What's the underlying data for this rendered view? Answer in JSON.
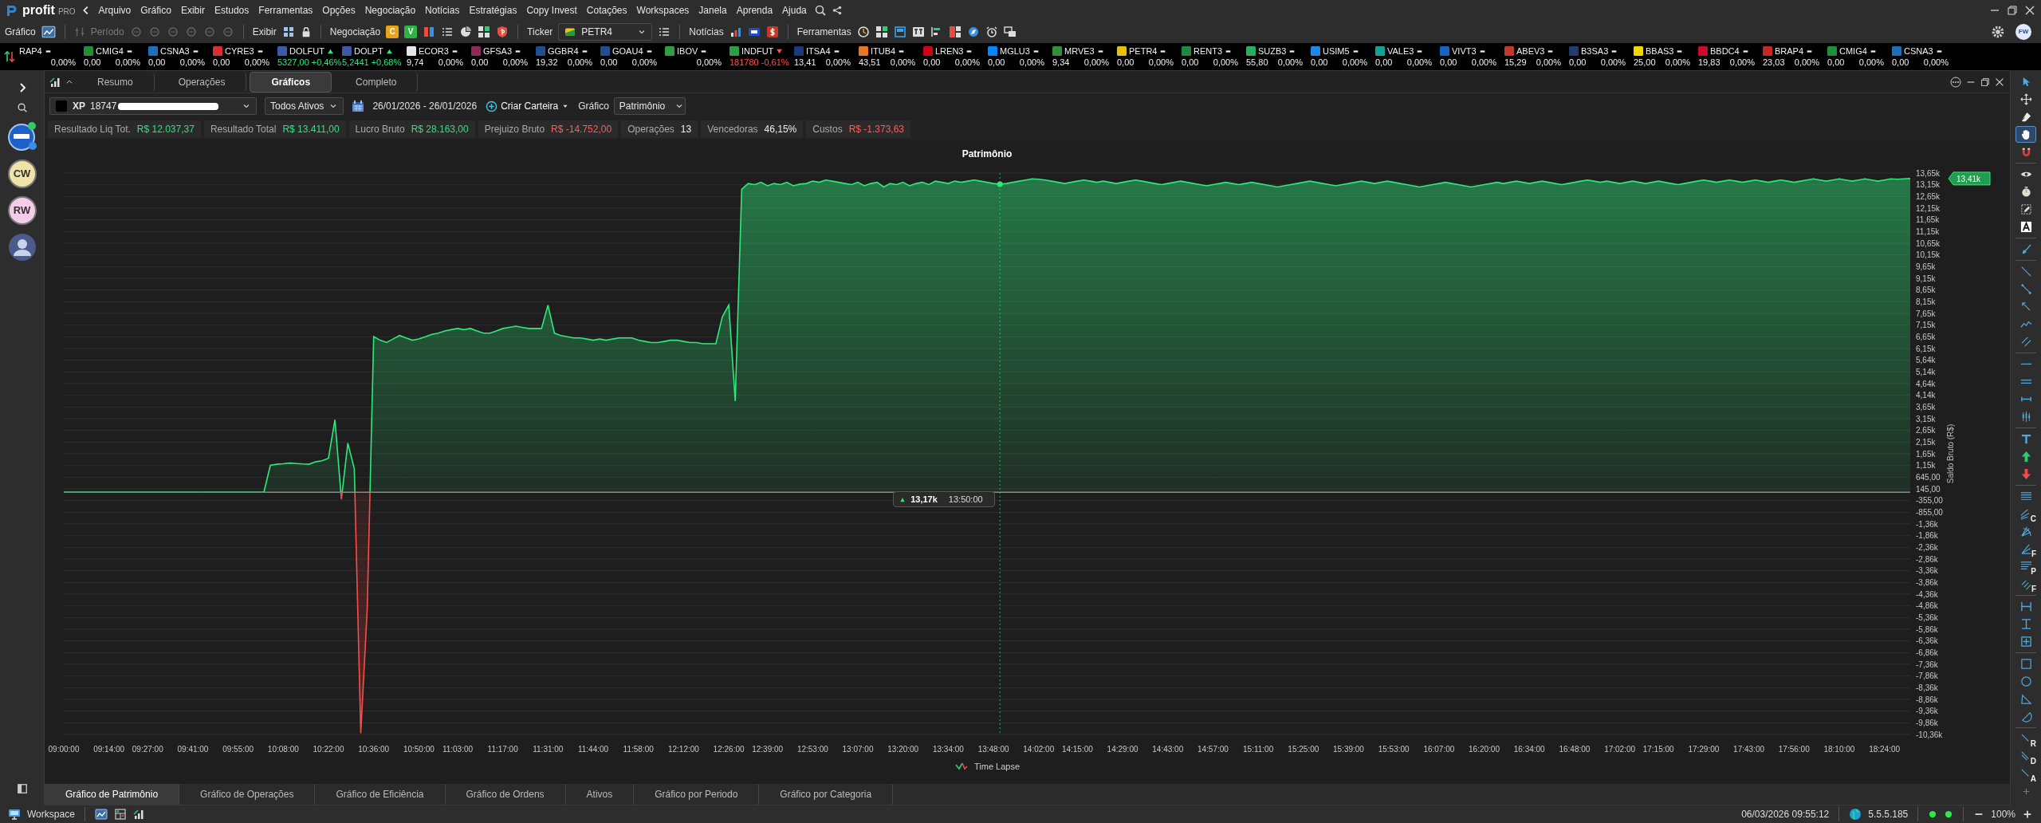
{
  "app": {
    "logo": "profit",
    "edition": "PRO"
  },
  "menu": [
    "Arquivo",
    "Gráfico",
    "Exibir",
    "Estudos",
    "Ferramentas",
    "Opções",
    "Negociação",
    "Notícias",
    "Estratégias",
    "Copy Invest",
    "Cotações",
    "Workspaces",
    "Janela",
    "Aprenda",
    "Ajuda"
  ],
  "toolbar": {
    "chart_label": "Gráfico",
    "period_label": "Período",
    "period_disabled": true,
    "view_label": "Exibir",
    "trading_label": "Negociação",
    "trading_buttons": [
      {
        "text": "C",
        "color": "#e8a317"
      },
      {
        "text": "V",
        "color": "#2fb344"
      }
    ],
    "ticker_label": "Ticker",
    "ticker_value": "PETR4",
    "news_label": "Notícias",
    "tools_label": "Ferramentas"
  },
  "user_avatar": "FW",
  "tickers": [
    {
      "symbol": "RAP4",
      "change": "0,00%",
      "kind": "flat"
    },
    {
      "symbol": "CMIG4",
      "price": "0,00",
      "change": "0,00%",
      "kind": "flat",
      "color": "#1f8f3a"
    },
    {
      "symbol": "CSNA3",
      "price": "0,00",
      "change": "0,00%",
      "kind": "flat",
      "color": "#1c6fb8"
    },
    {
      "symbol": "CYRE3",
      "price": "0,00",
      "change": "0,00%",
      "kind": "flat",
      "color": "#d63031"
    },
    {
      "symbol": "DOLFUT",
      "price": "5327,00",
      "change": "+0,46%",
      "kind": "up",
      "color": "#3c5aa6"
    },
    {
      "symbol": "DOLPT",
      "price": "5,2441",
      "change": "+0,68%",
      "kind": "up",
      "color": "#3c5aa6"
    },
    {
      "symbol": "ECOR3",
      "price": "9,74",
      "change": "0,00%",
      "kind": "flat",
      "color": "#e6e6e6"
    },
    {
      "symbol": "GFSA3",
      "price": "0,00",
      "change": "0,00%",
      "kind": "flat",
      "color": "#8e2a5a"
    },
    {
      "symbol": "GGBR4",
      "price": "19,32",
      "change": "0,00%",
      "kind": "flat",
      "color": "#1d4f91"
    },
    {
      "symbol": "GOAU4",
      "price": "0,00",
      "change": "0,00%",
      "kind": "flat",
      "color": "#1d4f91"
    },
    {
      "symbol": "IBOV",
      "change": "0,00%",
      "kind": "flat",
      "color": "#2e9e45"
    },
    {
      "symbol": "INDFUT",
      "price": "181780",
      "change": "-0,61%",
      "kind": "down",
      "color": "#2e9e45"
    },
    {
      "symbol": "ITSA4",
      "price": "13,41",
      "change": "0,00%",
      "kind": "flat",
      "color": "#1b3a7a"
    },
    {
      "symbol": "ITUB4",
      "price": "43,51",
      "change": "0,00%",
      "kind": "flat",
      "color": "#e87722"
    },
    {
      "symbol": "LREN3",
      "price": "0,00",
      "change": "0,00%",
      "kind": "flat",
      "color": "#d0021b"
    },
    {
      "symbol": "MGLU3",
      "price": "0,00",
      "change": "0,00%",
      "kind": "flat",
      "color": "#0086ff"
    },
    {
      "symbol": "MRVE3",
      "price": "9,34",
      "change": "0,00%",
      "kind": "flat",
      "color": "#2f8f3a"
    },
    {
      "symbol": "PETR4",
      "price": "0,00",
      "change": "0,00%",
      "kind": "flat",
      "color": "#e5c100"
    },
    {
      "symbol": "RENT3",
      "price": "0,00",
      "change": "0,00%",
      "kind": "flat",
      "color": "#1c8c3c"
    },
    {
      "symbol": "SUZB3",
      "price": "55,80",
      "change": "0,00%",
      "kind": "flat",
      "color": "#27ae60"
    },
    {
      "symbol": "USIM5",
      "price": "0,00",
      "change": "0,00%",
      "kind": "flat",
      "color": "#1e88e5"
    },
    {
      "symbol": "VALE3",
      "price": "0,00",
      "change": "0,00%",
      "kind": "flat",
      "color": "#12a19a"
    },
    {
      "symbol": "VIVT3",
      "price": "0,00",
      "change": "0,00%",
      "kind": "flat",
      "color": "#1565c0"
    },
    {
      "symbol": "ABEV3",
      "price": "15,29",
      "change": "0,00%",
      "kind": "flat",
      "color": "#c0392b"
    },
    {
      "symbol": "B3SA3",
      "price": "0,00",
      "change": "0,00%",
      "kind": "flat",
      "color": "#243b6b"
    },
    {
      "symbol": "BBAS3",
      "price": "25,00",
      "change": "0,00%",
      "kind": "flat",
      "color": "#f2d600"
    },
    {
      "symbol": "BBDC4",
      "price": "19,83",
      "change": "0,00%",
      "kind": "flat",
      "color": "#cc092f"
    },
    {
      "symbol": "BRAP4",
      "price": "23,03",
      "change": "0,00%",
      "kind": "flat",
      "color": "#c62828"
    },
    {
      "symbol": "CMIG4",
      "price": "0,00",
      "change": "0,00%",
      "kind": "flat",
      "color": "#1f8f3a"
    },
    {
      "symbol": "CSNA3",
      "price": "0,00",
      "change": "0,00%",
      "kind": "flat",
      "color": "#1c6fb8"
    }
  ],
  "sidebar": {
    "avatars": [
      {
        "kind": "app"
      },
      {
        "kind": "initials",
        "text": "CW",
        "color": "#f0e3a8"
      },
      {
        "kind": "initials",
        "text": "RW",
        "color": "#f6cde9"
      },
      {
        "kind": "photo"
      }
    ]
  },
  "panel_tabs": [
    {
      "label": "Resumo",
      "selected": false
    },
    {
      "label": "Operações",
      "selected": false
    },
    {
      "label": "Gráficos",
      "selected": true
    },
    {
      "label": "Completo",
      "selected": false
    }
  ],
  "filters": {
    "broker": "XP",
    "account": "18747",
    "scope": "Todos Ativos",
    "date_range": "26/01/2026 - 26/01/2026",
    "create_portfolio": "Criar Carteira",
    "chart_label": "Gráfico",
    "chart_type": "Patrimônio"
  },
  "stats": [
    {
      "label": "Resultado Liq Tot.",
      "value": "R$ 12.037,37",
      "color": "#33e07f"
    },
    {
      "label": "Resultado Total",
      "value": "R$ 13.411,00",
      "color": "#33e07f"
    },
    {
      "label": "Lucro Bruto",
      "value": "R$ 28.163,00",
      "color": "#33e07f"
    },
    {
      "label": "Prejuizo Bruto",
      "value": "R$ -14.752,00",
      "color": "#ff5c5c"
    },
    {
      "label": "Operações",
      "value": "13",
      "color": "#eeeeee"
    },
    {
      "label": "Vencedoras",
      "value": "46,15%",
      "color": "#eeeeee"
    },
    {
      "label": "Custos",
      "value": "R$ -1.373,63",
      "color": "#ff5c5c"
    }
  ],
  "chart": {
    "tooltip_time": "13:50:00",
    "last_value_label": "13,41k",
    "chart_data": {
      "type": "area",
      "title": "Patrimônio",
      "ylabel": "Saldo Bruto (R$)",
      "ylim": [
        -10355,
        13645
      ],
      "categories": [
        "09:00:00",
        null,
        null,
        null,
        null,
        null,
        null,
        "09:14:00",
        null,
        null,
        null,
        null,
        null,
        "09:27:00",
        null,
        null,
        null,
        null,
        null,
        null,
        "09:41:00",
        null,
        null,
        null,
        null,
        null,
        null,
        "09:55:00",
        null,
        null,
        null,
        null,
        null,
        null,
        "10:08:00",
        null,
        null,
        null,
        null,
        null,
        null,
        "10:22:00",
        null,
        null,
        null,
        null,
        null,
        null,
        "10:36:00",
        null,
        null,
        null,
        null,
        null,
        null,
        "10:50:00",
        null,
        null,
        null,
        null,
        null,
        "11:03:00",
        null,
        null,
        null,
        null,
        null,
        null,
        "11:17:00",
        null,
        null,
        null,
        null,
        null,
        null,
        "11:31:00",
        null,
        null,
        null,
        null,
        null,
        null,
        "11:44:00",
        null,
        null,
        null,
        null,
        null,
        null,
        "11:58:00",
        null,
        null,
        null,
        null,
        null,
        null,
        "12:12:00",
        null,
        null,
        null,
        null,
        null,
        null,
        "12:26:00",
        null,
        null,
        null,
        null,
        null,
        "12:39:00",
        null,
        null,
        null,
        null,
        null,
        null,
        "12:53:00",
        null,
        null,
        null,
        null,
        null,
        null,
        "13:07:00",
        null,
        null,
        null,
        null,
        null,
        null,
        "13:20:00",
        null,
        null,
        null,
        null,
        null,
        null,
        "13:34:00",
        null,
        null,
        null,
        null,
        null,
        null,
        "13:48:00",
        null,
        null,
        null,
        null,
        null,
        null,
        "14:02:00",
        null,
        null,
        null,
        null,
        null,
        "14:15:00",
        null,
        null,
        null,
        null,
        null,
        null,
        "14:29:00",
        null,
        null,
        null,
        null,
        null,
        null,
        "14:43:00",
        null,
        null,
        null,
        null,
        null,
        null,
        "14:57:00",
        null,
        null,
        null,
        null,
        null,
        null,
        "15:11:00",
        null,
        null,
        null,
        null,
        null,
        null,
        "15:25:00",
        null,
        null,
        null,
        null,
        null,
        null,
        "15:39:00",
        null,
        null,
        null,
        null,
        null,
        null,
        "15:53:00",
        null,
        null,
        null,
        null,
        null,
        null,
        "16:07:00",
        null,
        null,
        null,
        null,
        null,
        null,
        "16:20:00",
        null,
        null,
        null,
        null,
        null,
        null,
        "16:34:00",
        null,
        null,
        null,
        null,
        null,
        null,
        "16:48:00",
        null,
        null,
        null,
        null,
        null,
        null,
        "17:02:00",
        null,
        null,
        null,
        null,
        null,
        "17:15:00",
        null,
        null,
        null,
        null,
        null,
        null,
        "17:29:00",
        null,
        null,
        null,
        null,
        null,
        null,
        "17:43:00",
        null,
        null,
        null,
        null,
        null,
        null,
        "17:56:00",
        null,
        null,
        null,
        null,
        null,
        null,
        "18:10:00",
        null,
        null,
        null,
        null,
        null,
        null,
        "18:24:00",
        null,
        null,
        null,
        null
      ],
      "series": [
        {
          "name": "Time Lapse",
          "color": "#2ee87a",
          "values": [
            0,
            0,
            0,
            0,
            0,
            0,
            0,
            0,
            0,
            0,
            0,
            0,
            0,
            0,
            0,
            0,
            0,
            0,
            0,
            0,
            0,
            0,
            0,
            0,
            0,
            0,
            0,
            0,
            0,
            0,
            0,
            0,
            1150,
            1200,
            1220,
            1250,
            1230,
            1210,
            1200,
            1300,
            1350,
            1450,
            3100,
            -300,
            2100,
            1000,
            -10300,
            -5000,
            6650,
            6500,
            6400,
            6550,
            6700,
            6600,
            6500,
            6550,
            6650,
            6750,
            6800,
            6900,
            6950,
            7000,
            6950,
            7000,
            6900,
            6800,
            6800,
            6900,
            7000,
            7050,
            7100,
            7050,
            7000,
            7000,
            7000,
            8000,
            6800,
            6700,
            6650,
            6600,
            6600,
            6550,
            6500,
            6550,
            6500,
            6550,
            6600,
            6600,
            6600,
            6500,
            6450,
            6400,
            6400,
            6450,
            6500,
            6500,
            6450,
            6400,
            6400,
            6350,
            6350,
            6350,
            7500,
            8000,
            3900,
            12950,
            13200,
            13150,
            13250,
            13100,
            13200,
            13150,
            13250,
            13100,
            13170,
            13200,
            13300,
            13250,
            13350,
            13300,
            13250,
            13200,
            13150,
            13250,
            13100,
            13200,
            13250,
            13050,
            13200,
            13150,
            13250,
            13100,
            13200,
            13250,
            13150,
            13300,
            13250,
            13200,
            13300,
            13250,
            13300,
            13350,
            13300,
            13250,
            13200,
            13170,
            13200,
            13250,
            13300,
            13350,
            13400,
            13380,
            13350,
            13300,
            13250,
            13200,
            13250,
            13300,
            13350,
            13300,
            13250,
            13300,
            13250,
            13200,
            13250,
            13300,
            13350,
            13300,
            13250,
            13200,
            13150,
            13200,
            13250,
            13300,
            13250,
            13200,
            13150,
            13100,
            13150,
            13200,
            13250,
            13200,
            13150,
            13200,
            13250,
            13200,
            13150,
            13100,
            13050,
            13100,
            13150,
            13200,
            13250,
            13300,
            13250,
            13200,
            13150,
            13100,
            13150,
            13200,
            13250,
            13300,
            13250,
            13200,
            13250,
            13300,
            13250,
            13200,
            13150,
            13100,
            13050,
            13100,
            13150,
            13200,
            13250,
            13200,
            13150,
            13100,
            13050,
            13100,
            13150,
            13200,
            13250,
            13200,
            13250,
            13300,
            13250,
            13200,
            13250,
            13300,
            13250,
            13200,
            13150,
            13200,
            13250,
            13300,
            13350,
            13300,
            13250,
            13300,
            13250,
            13200,
            13250,
            13300,
            13250,
            13200,
            13250,
            13300,
            13250,
            13200,
            13150,
            13200,
            13250,
            13300,
            13350,
            13300,
            13250,
            13300,
            13350,
            13300,
            13250,
            13300,
            13350,
            13300,
            13250,
            13300,
            13350,
            13300,
            13250,
            13300,
            13350,
            13400,
            13350,
            13300,
            13350,
            13400,
            13350,
            13300,
            13350,
            13400,
            13350,
            13300,
            13350,
            13400,
            13380,
            13400,
            13410
          ]
        }
      ],
      "yticks": [
        {
          "value": 13645,
          "label": "13,65k"
        },
        {
          "value": 13145,
          "label": "13,15k"
        },
        {
          "value": 12645,
          "label": "12,65k"
        },
        {
          "value": 12145,
          "label": "12,15k"
        },
        {
          "value": 11645,
          "label": "11,65k"
        },
        {
          "value": 11145,
          "label": "11,15k"
        },
        {
          "value": 10645,
          "label": "10,65k"
        },
        {
          "value": 10145,
          "label": "10,15k"
        },
        {
          "value": 9645,
          "label": "9,65k"
        },
        {
          "value": 9145,
          "label": "9,15k"
        },
        {
          "value": 8645,
          "label": "8,65k"
        },
        {
          "value": 8145,
          "label": "8,15k"
        },
        {
          "value": 7645,
          "label": "7,65k"
        },
        {
          "value": 7145,
          "label": "7,15k"
        },
        {
          "value": 6645,
          "label": "6,65k"
        },
        {
          "value": 6145,
          "label": "6,15k"
        },
        {
          "value": 5645,
          "label": "5,64k"
        },
        {
          "value": 5145,
          "label": "5,14k"
        },
        {
          "value": 4645,
          "label": "4,64k"
        },
        {
          "value": 4145,
          "label": "4,14k"
        },
        {
          "value": 3645,
          "label": "3,65k"
        },
        {
          "value": 3145,
          "label": "3,15k"
        },
        {
          "value": 2645,
          "label": "2,65k"
        },
        {
          "value": 2145,
          "label": "2,15k"
        },
        {
          "value": 1645,
          "label": "1,65k"
        },
        {
          "value": 1145,
          "label": "1,15k"
        },
        {
          "value": 645,
          "label": "645,00"
        },
        {
          "value": 145,
          "label": "145,00"
        },
        {
          "value": -355,
          "label": "-355,00"
        },
        {
          "value": -855,
          "label": "-855,00"
        },
        {
          "value": -1355,
          "label": "-1,36k"
        },
        {
          "value": -1855,
          "label": "-1,86k"
        },
        {
          "value": -2355,
          "label": "-2,36k"
        },
        {
          "value": -2855,
          "label": "-2,86k"
        },
        {
          "value": -3355,
          "label": "-3,36k"
        },
        {
          "value": -3855,
          "label": "-3,86k"
        },
        {
          "value": -4355,
          "label": "-4,36k"
        },
        {
          "value": -4855,
          "label": "-4,86k"
        },
        {
          "value": -5355,
          "label": "-5,36k"
        },
        {
          "value": -5855,
          "label": "-5,86k"
        },
        {
          "value": -6355,
          "label": "-6,36k"
        },
        {
          "value": -6855,
          "label": "-6,86k"
        },
        {
          "value": -7355,
          "label": "-7,36k"
        },
        {
          "value": -7855,
          "label": "-7,86k"
        },
        {
          "value": -8355,
          "label": "-8,36k"
        },
        {
          "value": -8855,
          "label": "-8,86k"
        },
        {
          "value": -9355,
          "label": "-9,36k"
        },
        {
          "value": -9855,
          "label": "-9,86k"
        },
        {
          "value": -10355,
          "label": "-10,36k"
        }
      ],
      "grid": true,
      "annotations": [
        "13,17k"
      ]
    }
  },
  "bottom_tabs": [
    {
      "label": "Gráfico de Patrimônio",
      "selected": true
    },
    {
      "label": "Gráfico de Operações",
      "selected": false
    },
    {
      "label": "Gráfico de Eficiência",
      "selected": false
    },
    {
      "label": "Gráfico de Ordens",
      "selected": false
    },
    {
      "label": "Ativos",
      "selected": false
    },
    {
      "label": "Gráfico por Periodo",
      "selected": false
    },
    {
      "label": "Gráfico por Categoria",
      "selected": false
    }
  ],
  "drawing_tools": [
    {
      "kind": "pointer",
      "selected": false
    },
    {
      "kind": "move",
      "selected": false
    },
    {
      "kind": "eraser",
      "selected": false
    },
    {
      "kind": "hand",
      "selected": true
    },
    {
      "kind": "magnet",
      "selected": false
    },
    {
      "kind": "eye",
      "selected": false
    },
    {
      "kind": "timer",
      "selected": false
    },
    {
      "kind": "pencil",
      "selected": false
    },
    {
      "kind": "textbox",
      "selected": false
    },
    {
      "kind": "brush",
      "selected": false
    },
    {
      "kind": "line",
      "selected": false
    },
    {
      "kind": "segment",
      "selected": false
    },
    {
      "kind": "arrowline",
      "selected": false
    },
    {
      "kind": "polyline",
      "selected": false
    },
    {
      "kind": "channel",
      "selected": false
    },
    {
      "kind": "hline",
      "selected": false
    },
    {
      "kind": "dhline",
      "selected": false
    },
    {
      "kind": "range",
      "selected": false
    },
    {
      "kind": "candles",
      "selected": false
    },
    {
      "kind": "text",
      "selected": false
    },
    {
      "kind": "uparrow",
      "selected": false
    },
    {
      "kind": "downarrow",
      "selected": false
    },
    {
      "kind": "stack",
      "selected": false
    },
    {
      "kind": "fan",
      "letter": "C",
      "selected": false
    },
    {
      "kind": "arc",
      "selected": false
    },
    {
      "kind": "angle",
      "letter": "F",
      "selected": false
    },
    {
      "kind": "lines",
      "letter": "P",
      "selected": false
    },
    {
      "kind": "zigzag",
      "letter": "F",
      "selected": false
    },
    {
      "kind": "rulerh",
      "selected": false
    },
    {
      "kind": "rulerv",
      "selected": false
    },
    {
      "kind": "plusbox",
      "selected": false
    },
    {
      "kind": "square",
      "selected": false
    },
    {
      "kind": "circle",
      "selected": false
    },
    {
      "kind": "triangle",
      "selected": false
    },
    {
      "kind": "halfcircle",
      "selected": false
    },
    {
      "kind": "diag",
      "letter": "R",
      "selected": false
    },
    {
      "kind": "ddiag",
      "letter": "D",
      "selected": false
    },
    {
      "kind": "diag",
      "letter": "A",
      "selected": false
    },
    {
      "kind": "add",
      "selected": false
    }
  ],
  "status_bar": {
    "workspace": "Workspace",
    "datetime": "06/03/2026 09:55:12",
    "server": "5.5.5.185",
    "zoom": "100%"
  }
}
